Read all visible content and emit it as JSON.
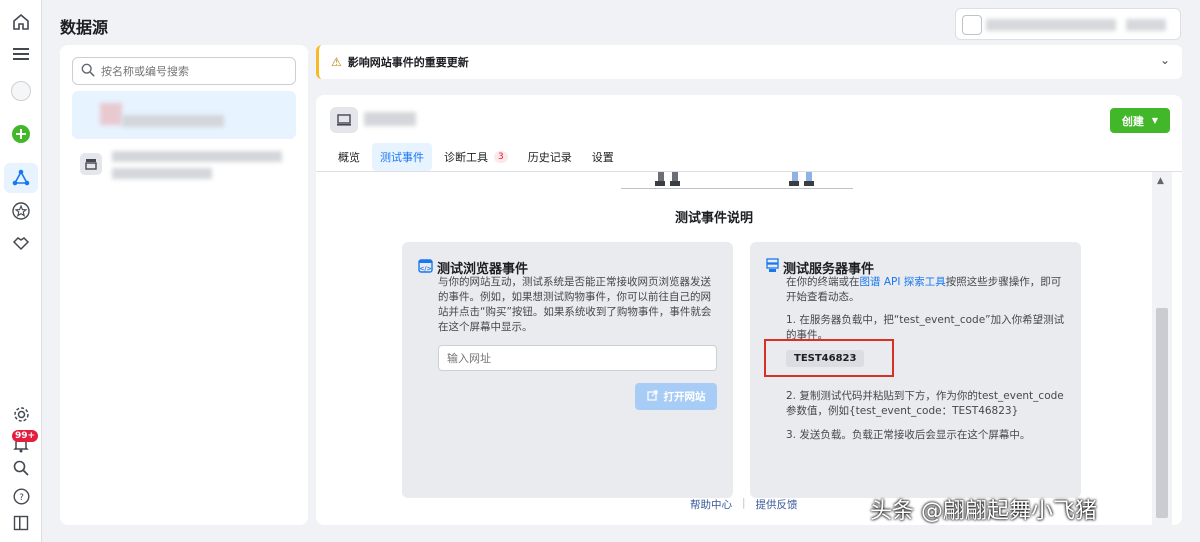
{
  "page_title": "数据源",
  "left_panel": {
    "search_placeholder": "按名称或编号搜索"
  },
  "alert": {
    "icon": "warning-icon",
    "text": "影响网站事件的重要更新"
  },
  "header": {
    "create_label": "创建"
  },
  "tabs": [
    {
      "label": "概览"
    },
    {
      "label": "测试事件"
    },
    {
      "label": "诊断工具",
      "badge": "3"
    },
    {
      "label": "历史记录"
    },
    {
      "label": "设置"
    }
  ],
  "section_title": "测试事件说明",
  "browser_card": {
    "title": "测试浏览器事件",
    "description": "与你的网站互动，测试系统是否能正常接收网页浏览器发送的事件。例如，如果想测试购物事件，你可以前往自己的网站并点击“购买”按钮。如果系统收到了购物事件，事件就会在这个屏幕中显示。",
    "url_placeholder": "输入网址",
    "open_label": "打开网站"
  },
  "server_card": {
    "title": "测试服务器事件",
    "intro_pre": "在你的终端或在",
    "intro_link": "图谱 API 探索工具",
    "intro_post": "按照这些步骤操作，即可开始查看动态。",
    "step1": "1. 在服务器负载中，把“test_event_code”加入你希望测试的事件。",
    "code": "TEST46823",
    "step2": "2. 复制测试代码并粘贴到下方，作为你的test_event_code参数值，例如{test_event_code：TEST46823}",
    "step3": "3. 发送负载。负载正常接收后会显示在这个屏幕中。"
  },
  "footer": {
    "help": "帮助中心",
    "feedback": "提供反馈"
  },
  "notifications_badge": "99+",
  "watermark": "头条 @翩翩起舞小飞猪",
  "colors": {
    "accent": "#1877f2",
    "create": "#42b72a",
    "alert": "#f7b928",
    "highlight": "#d93025"
  }
}
